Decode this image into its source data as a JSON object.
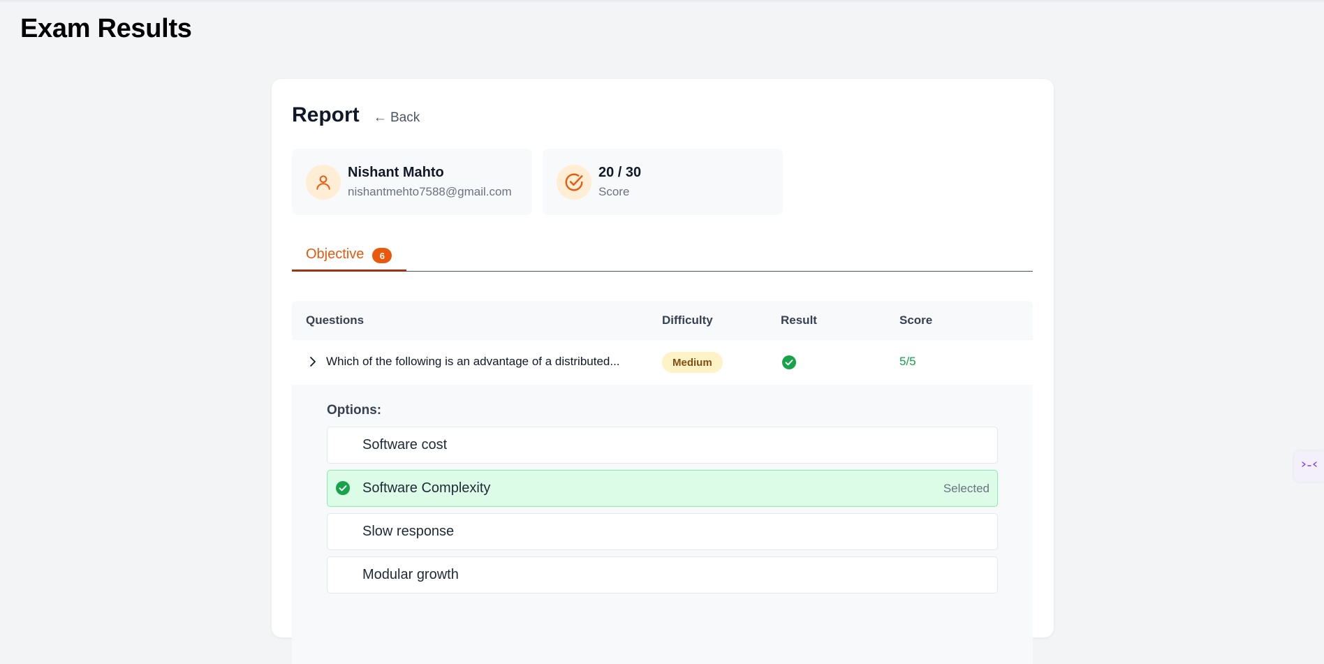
{
  "page": {
    "title": "Exam Results"
  },
  "report": {
    "title": "Report",
    "back_label": "← Back"
  },
  "user": {
    "name": "Nishant Mahto",
    "email": "nishantmehto7588@gmail.com"
  },
  "score": {
    "value": "20 / 30",
    "label": "Score"
  },
  "tabs": [
    {
      "label": "Objective",
      "count": "6",
      "active": true
    }
  ],
  "table": {
    "headers": {
      "questions": "Questions",
      "difficulty": "Difficulty",
      "result": "Result",
      "score": "Score"
    },
    "rows": [
      {
        "question": "Which of the following is an advantage of a distributed...",
        "difficulty": "Medium",
        "result": "correct",
        "score": "5/5",
        "expanded": true,
        "options_label": "Options:",
        "options": [
          {
            "text": "Software cost",
            "selected": false,
            "tag": ""
          },
          {
            "text": "Software Complexity",
            "selected": true,
            "tag": "Selected"
          },
          {
            "text": "Slow response",
            "selected": false,
            "tag": ""
          },
          {
            "text": "Modular growth",
            "selected": false,
            "tag": ""
          }
        ]
      }
    ]
  },
  "icons": {
    "user": "user-icon",
    "score": "check-circle-icon",
    "expand": "chevron-right-icon",
    "result": "check-badge-icon",
    "widget": "collapse-arrows-icon"
  },
  "colors": {
    "accent": "#ea580c",
    "success": "#16a34a",
    "selected_bg": "#dcfce7",
    "badge_medium_bg": "#fef3c7"
  }
}
